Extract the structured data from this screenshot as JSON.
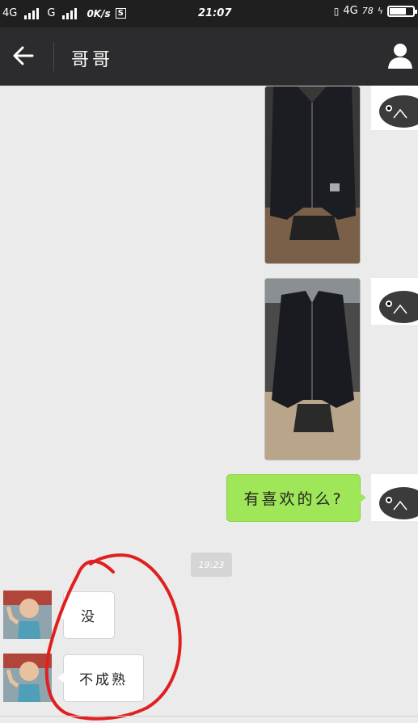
{
  "status_bar": {
    "net1": "4G",
    "net2": "G",
    "speed": "0K/s",
    "sim_icon": "S",
    "time": "21:07",
    "net3": "4G",
    "battery_percent": "78",
    "battery_level": 0.78
  },
  "header": {
    "back_icon": "arrow-left-icon",
    "title": "哥哥",
    "profile_icon": "person-icon"
  },
  "messages": [
    {
      "side": "me",
      "type": "image",
      "description_icon": "jacket-photo"
    },
    {
      "side": "me",
      "type": "image",
      "description_icon": "jacket-photo"
    },
    {
      "side": "me",
      "type": "text",
      "text": "有喜欢的么?"
    },
    {
      "type": "timestamp",
      "text": "19:23"
    },
    {
      "side": "them",
      "type": "text",
      "text": "没"
    },
    {
      "side": "them",
      "type": "text",
      "text": "不成熟"
    }
  ],
  "colors": {
    "background": "#ebebeb",
    "header": "#2c2c2e",
    "my_bubble": "#9fe658",
    "annotation": "#e02020"
  }
}
